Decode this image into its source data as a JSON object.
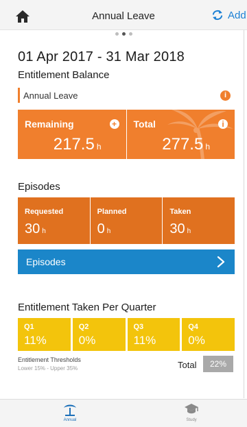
{
  "header": {
    "title": "Annual Leave",
    "add_label": "Add"
  },
  "pager": {
    "count": 3,
    "active_index": 1
  },
  "period": {
    "start": "01 Apr 2017",
    "separator": "-",
    "end": "31 Mar 2018"
  },
  "entitlement": {
    "title": "Entitlement Balance",
    "leave_type": "Annual Leave",
    "info_glyph": "i",
    "remaining": {
      "label": "Remaining",
      "value": "217.5",
      "unit": "h",
      "icon_glyph": "+"
    },
    "total": {
      "label": "Total",
      "value": "277.5",
      "unit": "h",
      "icon_glyph": "i"
    }
  },
  "episodes": {
    "title": "Episodes",
    "cards": [
      {
        "label": "Requested",
        "value": "30",
        "unit": "h"
      },
      {
        "label": "Planned",
        "value": "0",
        "unit": "h"
      },
      {
        "label": "Taken",
        "value": "30",
        "unit": "h"
      }
    ],
    "button_label": "Episodes"
  },
  "quarters": {
    "title": "Entitlement Taken Per Quarter",
    "items": [
      {
        "label": "Q1",
        "value": "11%"
      },
      {
        "label": "Q2",
        "value": "0%"
      },
      {
        "label": "Q3",
        "value": "11%"
      },
      {
        "label": "Q4",
        "value": "0%"
      }
    ],
    "thresholds_title": "Entitlement Thresholds",
    "thresholds_range": "Lower 15% - Upper 35%",
    "total_label": "Total",
    "total_value": "22%"
  },
  "tabbar": {
    "tabs": [
      {
        "label": "Annual",
        "active": true
      },
      {
        "label": "Study",
        "active": false
      }
    ]
  },
  "colors": {
    "accent_orange": "#f07f2d",
    "episodes_orange": "#e0711f",
    "action_blue": "#1b86c9",
    "quarter_yellow": "#f3c40c",
    "total_grey": "#a9a9a9"
  },
  "icons": {
    "home": "home-icon",
    "add": "refresh-icon",
    "next": "chevron-right-icon",
    "annual_tab": "palm-tree-icon",
    "study_tab": "graduation-cap-icon"
  }
}
